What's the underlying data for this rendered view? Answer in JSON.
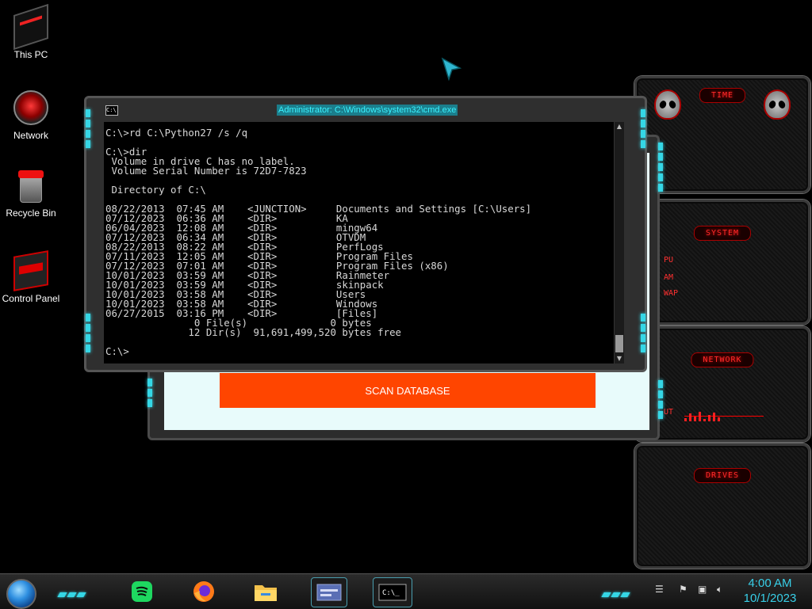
{
  "desktop": {
    "icons": [
      {
        "label": "This PC",
        "icon": "this-pc-icon"
      },
      {
        "label": "Network",
        "icon": "network-icon"
      },
      {
        "label": "Recycle Bin",
        "icon": "recycle-bin-icon"
      },
      {
        "label": "Control Panel",
        "icon": "control-panel-icon"
      }
    ]
  },
  "cmd": {
    "title": "Administrator: C:\\Windows\\system32\\cmd.exe",
    "output": "C:\\>rd C:\\Python27 /s /q\n\nC:\\>dir\n Volume in drive C has no label.\n Volume Serial Number is 72D7-7823\n\n Directory of C:\\\n\n08/22/2013  07:45 AM    <JUNCTION>     Documents and Settings [C:\\Users]\n07/12/2023  06:36 AM    <DIR>          KA\n06/04/2023  12:08 AM    <DIR>          mingw64\n07/12/2023  06:34 AM    <DIR>          OTVDM\n08/22/2013  08:22 AM    <DIR>          PerfLogs\n07/11/2023  12:05 AM    <DIR>          Program Files\n07/12/2023  07:01 AM    <DIR>          Program Files (x86)\n10/01/2023  03:59 AM    <DIR>          Rainmeter\n10/01/2023  03:59 AM    <DIR>          skinpack\n10/01/2023  03:58 AM    <DIR>          Users\n10/01/2023  03:58 AM    <DIR>          Windows\n06/27/2015  03:16 PM    <DIR>          [Files]\n               0 File(s)              0 bytes\n              12 Dir(s)  91,691,499,520 bytes free\n\nC:\\>"
  },
  "app_window": {
    "button_label": "SCAN DATABASE",
    "accent": "#ff4500"
  },
  "gadgets": {
    "time_title": "TIME",
    "system_title": "SYSTEM",
    "system_lines": [
      "PU",
      "AM",
      "WAP"
    ],
    "network_title": "NETWORK",
    "network_line": "UT",
    "drives_title": "DRIVES"
  },
  "taskbar": {
    "apps": [
      "spotify-icon",
      "firefox-icon",
      "file-explorer-icon",
      "app-window-icon",
      "cmd-icon"
    ],
    "tray": [
      "flag-icon",
      "network-tray-icon",
      "volume-icon"
    ],
    "time": "4:00 AM",
    "date": "10/1/2023"
  },
  "colors": {
    "accent_cyan": "#35d7e6",
    "accent_red": "#ff2b2b",
    "clock": "#38cfe8"
  }
}
